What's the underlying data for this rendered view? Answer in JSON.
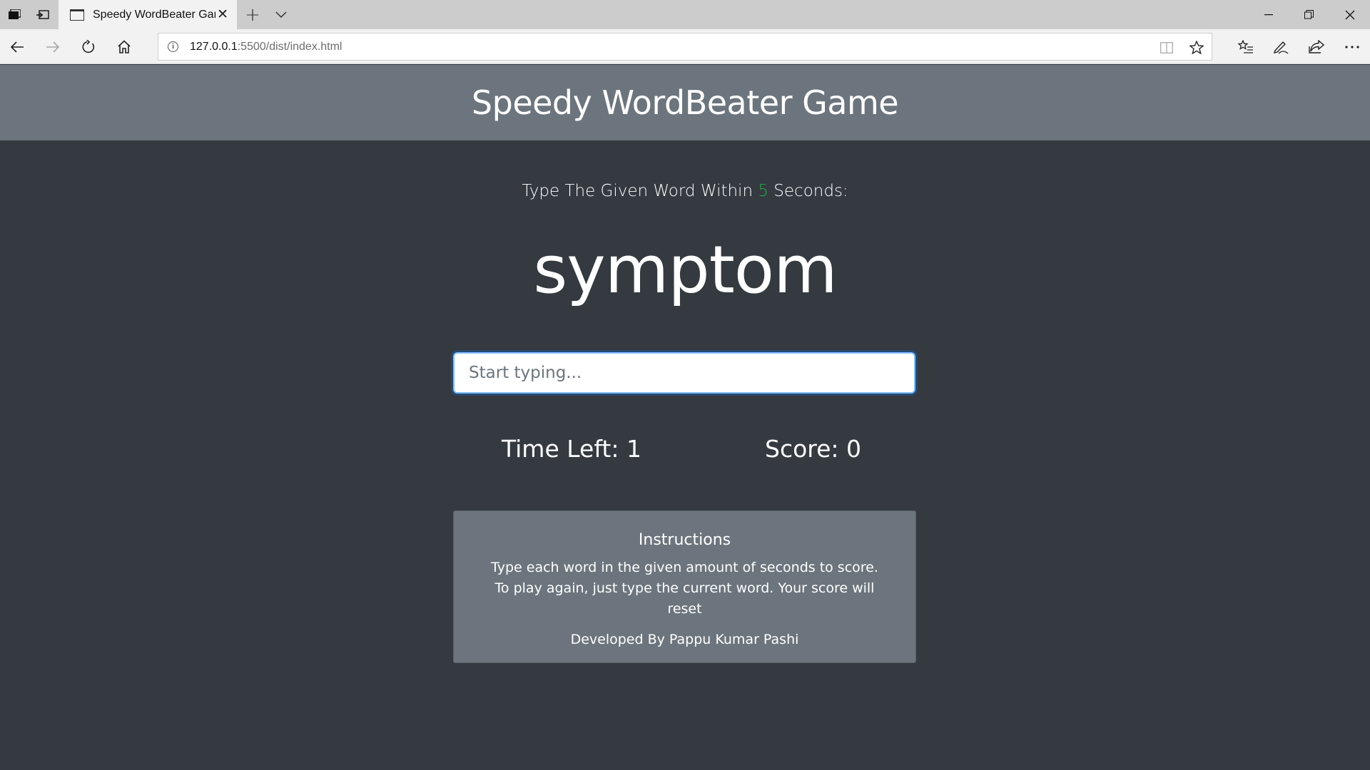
{
  "browser": {
    "tab_title": "Speedy WordBeater Game",
    "url_host": "127.0.0.1",
    "url_path": ":5500/dist/index.html"
  },
  "game": {
    "title": "Speedy WordBeater Game",
    "lead_prefix": "Type The Given Word Within",
    "seconds": "5",
    "lead_suffix": "Seconds:",
    "current_word": "symptom",
    "input_placeholder": "Start typing...",
    "time_label": "Time Left:",
    "time_value": "1",
    "score_label": "Score:",
    "score_value": "0"
  },
  "instructions": {
    "heading": "Instructions",
    "body": "Type each word in the given amount of seconds to score. To play again, just type the current word. Your score will reset",
    "credit": "Developed By Pappu Kumar Pashi"
  },
  "colors": {
    "header_bg": "#6c757d",
    "page_bg": "#343a40",
    "seconds_accent": "#28a745",
    "card_bg": "#6c757d"
  }
}
